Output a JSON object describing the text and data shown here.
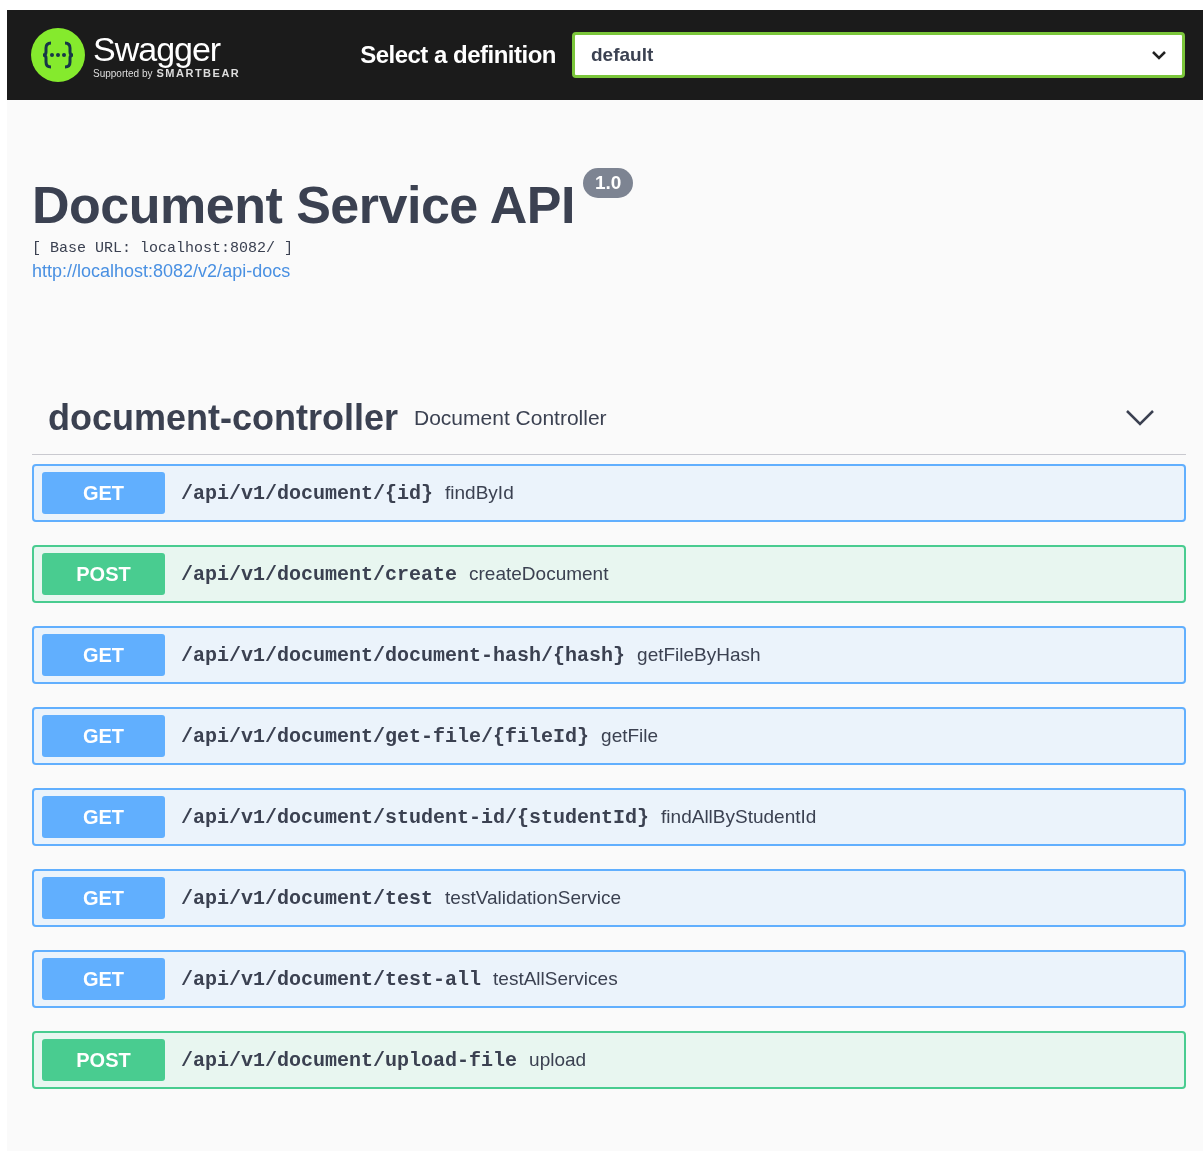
{
  "topbar": {
    "brand": "Swagger",
    "tagline_prefix": "Supported by",
    "tagline_brand": "SMARTBEAR",
    "select_label": "Select a definition",
    "select_value": "default"
  },
  "info": {
    "title": "Document Service API",
    "version": "1.0",
    "base_url": "[ Base URL: localhost:8082/ ]",
    "docs_link": "http://localhost:8082/v2/api-docs"
  },
  "section": {
    "name": "document-controller",
    "description": "Document Controller",
    "expanded": true,
    "operations": [
      {
        "method": "GET",
        "path": "/api/v1/document/{id}",
        "summary": "findById"
      },
      {
        "method": "POST",
        "path": "/api/v1/document/create",
        "summary": "createDocument"
      },
      {
        "method": "GET",
        "path": "/api/v1/document/document-hash/{hash}",
        "summary": "getFileByHash"
      },
      {
        "method": "GET",
        "path": "/api/v1/document/get-file/{fileId}",
        "summary": "getFile"
      },
      {
        "method": "GET",
        "path": "/api/v1/document/student-id/{studentId}",
        "summary": "findAllByStudentId"
      },
      {
        "method": "GET",
        "path": "/api/v1/document/test",
        "summary": "testValidationService"
      },
      {
        "method": "GET",
        "path": "/api/v1/document/test-all",
        "summary": "testAllServices"
      },
      {
        "method": "POST",
        "path": "/api/v1/document/upload-file",
        "summary": "upload"
      }
    ]
  }
}
